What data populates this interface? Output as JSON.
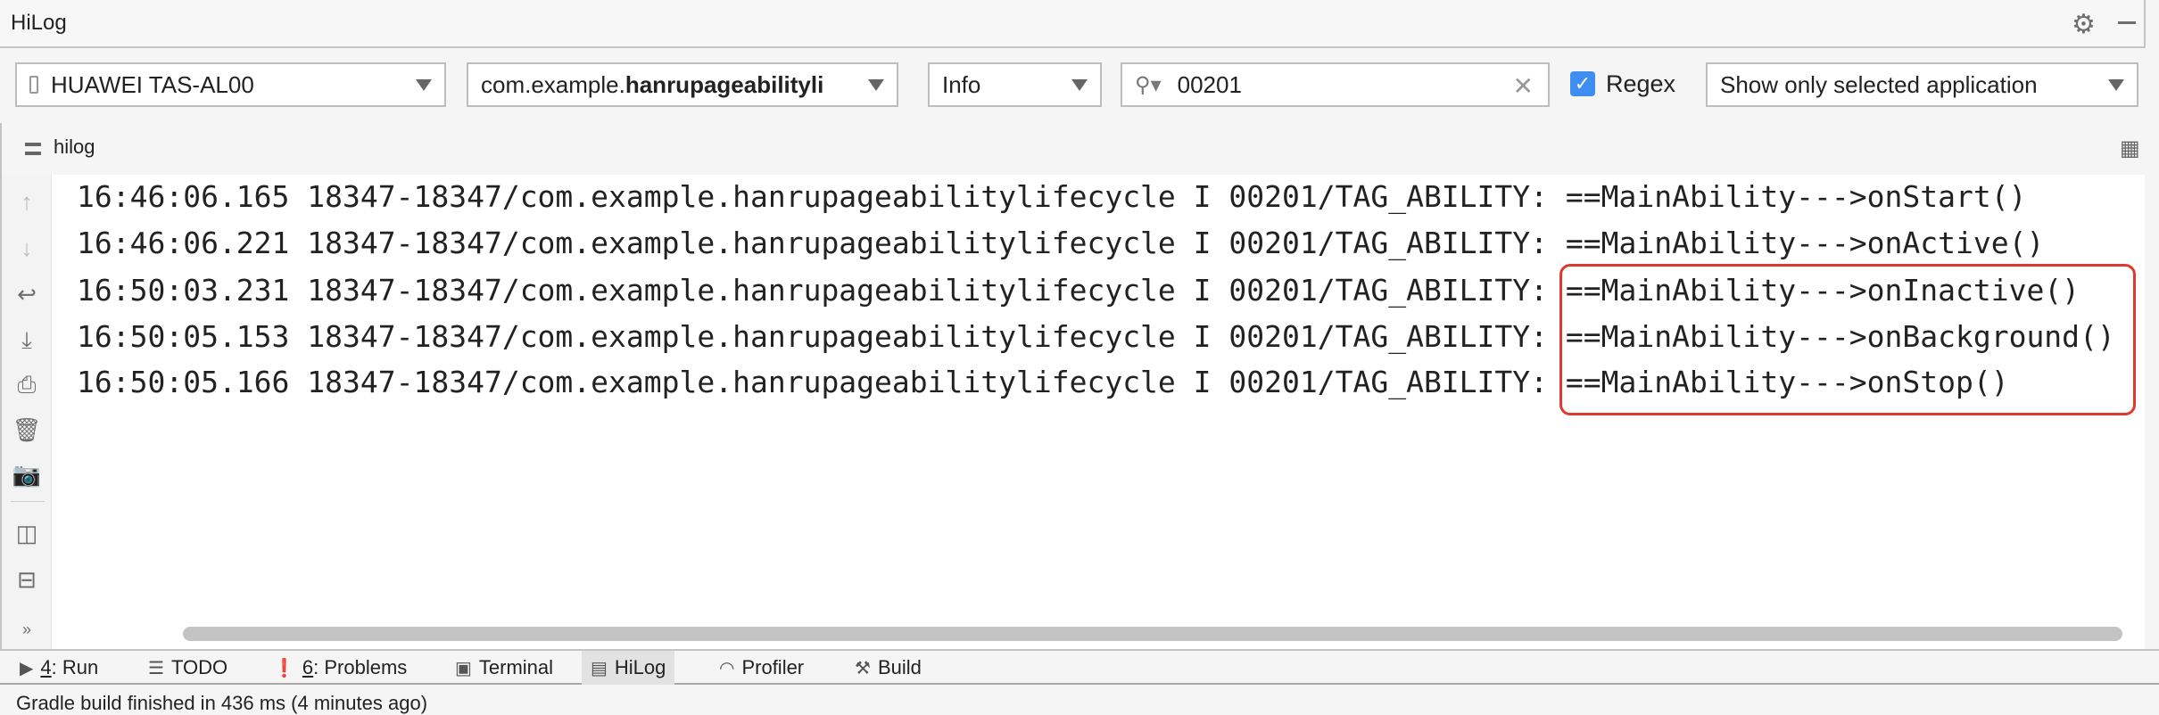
{
  "window": {
    "title": "HiLog"
  },
  "toolbar": {
    "device": "HUAWEI TAS-AL00",
    "app_prefix": "com.example.",
    "app_bold": "hanrupageabilityli",
    "level": "Info",
    "search_value": "00201",
    "regex_label": "Regex",
    "regex_checked": true,
    "filter": "Show only selected application"
  },
  "log_header": {
    "label": "hilog"
  },
  "logs": [
    "16:46:06.165 18347-18347/com.example.hanrupageabilitylifecycle I 00201/TAG_ABILITY: ==MainAbility--->onStart()",
    "16:46:06.221 18347-18347/com.example.hanrupageabilitylifecycle I 00201/TAG_ABILITY: ==MainAbility--->onActive()",
    "16:50:03.231 18347-18347/com.example.hanrupageabilitylifecycle I 00201/TAG_ABILITY: ==MainAbility--->onInactive()",
    "16:50:05.153 18347-18347/com.example.hanrupageabilitylifecycle I 00201/TAG_ABILITY: ==MainAbility--->onBackground()",
    "16:50:05.166 18347-18347/com.example.hanrupageabilitylifecycle I 00201/TAG_ABILITY: ==MainAbility--->onStop()"
  ],
  "highlight_color": "#e0392d",
  "tabs": [
    {
      "num": "4",
      "label": ": Run"
    },
    {
      "label": "TODO"
    },
    {
      "num": "6",
      "label": ": Problems"
    },
    {
      "label": "Terminal"
    },
    {
      "label": "HiLog",
      "active": true
    },
    {
      "label": "Profiler"
    },
    {
      "label": "Build"
    }
  ],
  "status": "Gradle build finished in 436 ms (4 minutes ago)"
}
